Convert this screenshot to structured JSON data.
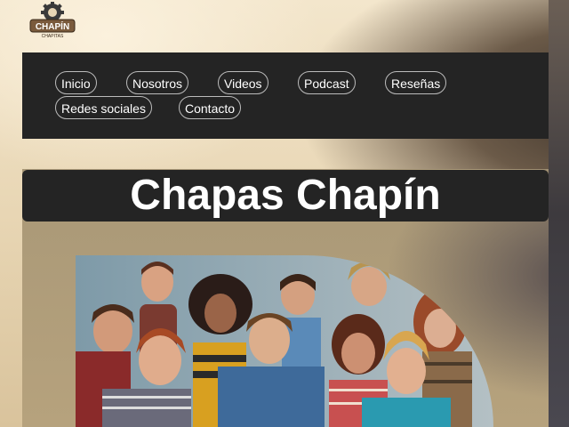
{
  "logo": {
    "text": "CHAPÍN",
    "sub": "CHAPITAS"
  },
  "nav": {
    "items": [
      {
        "label": "Inicio"
      },
      {
        "label": "Nosotros"
      },
      {
        "label": "Videos"
      },
      {
        "label": "Podcast"
      },
      {
        "label": "Reseñas"
      },
      {
        "label": "Redes sociales"
      },
      {
        "label": "Contacto"
      }
    ]
  },
  "page": {
    "title": "Chapas Chapín"
  },
  "colors": {
    "nav_bg": "#242424",
    "text": "#ffffff",
    "pill_border": "#bbbbbb"
  }
}
